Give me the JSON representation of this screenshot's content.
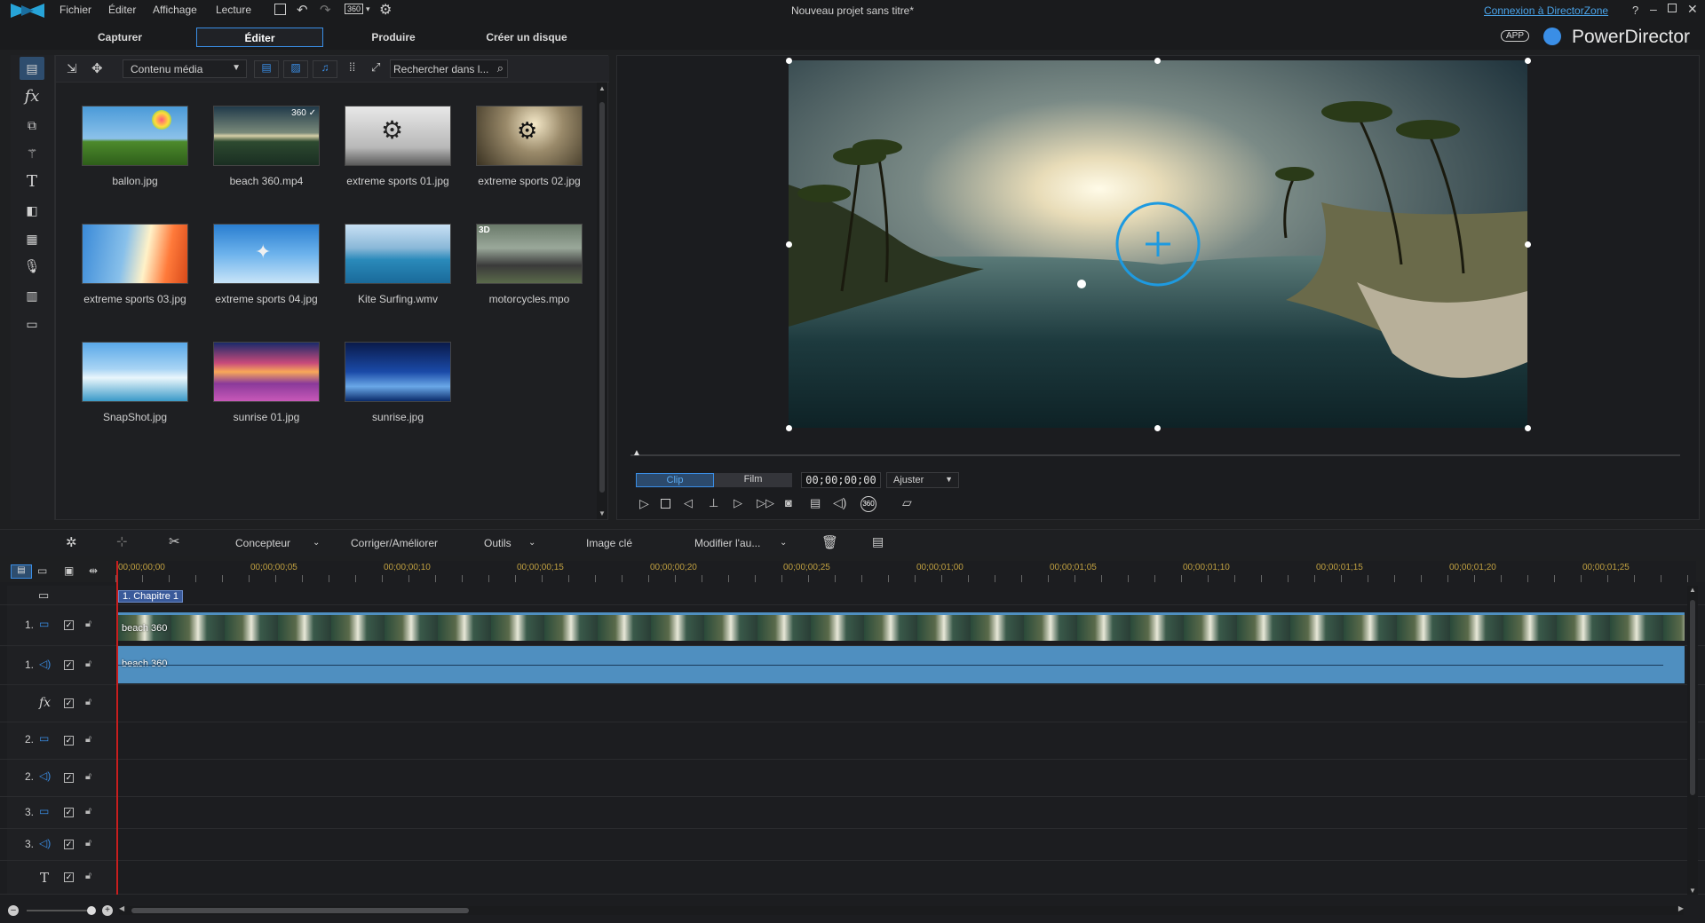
{
  "app": {
    "window_title": "Nouveau projet sans titre*",
    "brand": "PowerDirector",
    "app_badge": "APP",
    "login_link": "Connexion à DirectorZone",
    "help": "?"
  },
  "menu": {
    "items": [
      "Fichier",
      "Éditer",
      "Affichage",
      "Lecture"
    ],
    "badge_360": "360"
  },
  "tabs": [
    {
      "label": "Capturer"
    },
    {
      "label": "Éditer"
    },
    {
      "label": "Produire"
    },
    {
      "label": "Créer un disque"
    }
  ],
  "library": {
    "dropdown": "Contenu média",
    "search_placeholder": "Rechercher dans l...",
    "items": [
      {
        "name": "ballon.jpg",
        "badge": ""
      },
      {
        "name": "beach 360.mp4",
        "badge": "360 ✓"
      },
      {
        "name": "extreme sports 01.jpg",
        "badge": ""
      },
      {
        "name": "extreme sports 02.jpg",
        "badge": ""
      },
      {
        "name": "extreme sports 03.jpg",
        "badge": ""
      },
      {
        "name": "extreme sports 04.jpg",
        "badge": ""
      },
      {
        "name": "Kite Surfing.wmv",
        "badge": ""
      },
      {
        "name": "motorcycles.mpo",
        "badge": "3D"
      },
      {
        "name": "SnapShot.jpg",
        "badge": ""
      },
      {
        "name": "sunrise 01.jpg",
        "badge": ""
      },
      {
        "name": "sunrise.jpg",
        "badge": ""
      }
    ]
  },
  "preview": {
    "mode_clip": "Clip",
    "mode_film": "Film",
    "timecode": "00;00;00;00",
    "fit": "Ajuster"
  },
  "toolbar": {
    "designer": "Concepteur",
    "fix": "Corriger/Améliorer",
    "tools": "Outils",
    "keyframe": "Image clé",
    "modify": "Modifier l'au..."
  },
  "ruler": {
    "labels": [
      "00;00;00;00",
      "00;00;00;05",
      "00;00;00;10",
      "00;00;00;15",
      "00;00;00;20",
      "00;00;00;25",
      "00;00;01;00",
      "00;00;01;05",
      "00;00;01;10",
      "00;00;01;15",
      "00;00;01;20",
      "00;00;01;25"
    ]
  },
  "timeline": {
    "chapter": "1. Chapitre 1",
    "video_clip": "beach 360",
    "audio_clip": "beach 360",
    "tracks": [
      {
        "label": "1.",
        "type": "video"
      },
      {
        "label": "1.",
        "type": "audio"
      },
      {
        "label": "fx",
        "type": "fx"
      },
      {
        "label": "2.",
        "type": "video"
      },
      {
        "label": "2.",
        "type": "audio"
      },
      {
        "label": "3.",
        "type": "video"
      },
      {
        "label": "3.",
        "type": "audio"
      },
      {
        "label": "T",
        "type": "title"
      }
    ]
  },
  "colors": {
    "accent": "#3a8ee6",
    "clip_blue": "#4f8fc0"
  }
}
